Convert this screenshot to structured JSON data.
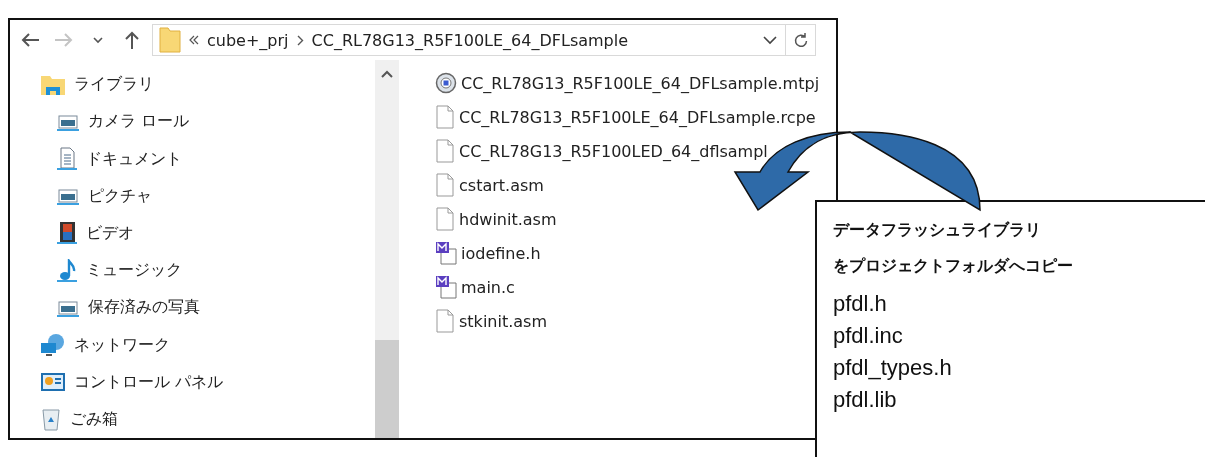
{
  "navigation": [
    {
      "kind": "back",
      "disabled": false
    },
    {
      "kind": "forward",
      "disabled": true
    },
    {
      "kind": "recent",
      "disabled": false
    },
    {
      "kind": "up",
      "disabled": false
    }
  ],
  "address_bar": {
    "path": [
      "cube+_prj",
      "CC_RL78G13_R5F100LE_64_DFLsample"
    ]
  },
  "sidebar": {
    "items": [
      {
        "label": "ライブラリ",
        "kind": "library",
        "children": [
          {
            "label": "カメラ ロール",
            "kind": "picture"
          },
          {
            "label": "ドキュメント",
            "kind": "document"
          },
          {
            "label": "ピクチャ",
            "kind": "picture"
          },
          {
            "label": "ビデオ",
            "kind": "video"
          },
          {
            "label": "ミュージック",
            "kind": "music"
          },
          {
            "label": "保存済みの写真",
            "kind": "picture"
          }
        ]
      },
      {
        "label": "ネットワーク",
        "kind": "network"
      },
      {
        "label": "コントロール パネル",
        "kind": "control-panel"
      },
      {
        "label": "ごみ箱",
        "kind": "trash"
      }
    ]
  },
  "files": [
    {
      "name": "CC_RL78G13_R5F100LE_64_DFLsample.mtpj",
      "kind": "project"
    },
    {
      "name": "CC_RL78G13_R5F100LE_64_DFLsample.rcpe",
      "kind": "plain"
    },
    {
      "name": "CC_RL78G13_R5F100LED_64_dflsampl",
      "kind": "plain"
    },
    {
      "name": "cstart.asm",
      "kind": "plain"
    },
    {
      "name": "hdwinit.asm",
      "kind": "plain"
    },
    {
      "name": "iodefine.h",
      "kind": "source"
    },
    {
      "name": "main.c",
      "kind": "source"
    },
    {
      "name": "stkinit.asm",
      "kind": "plain"
    }
  ],
  "callout": {
    "heading": [
      "データフラッシュライブラリ",
      "をプロジェクトフォルダへコピー"
    ],
    "files": [
      "pfdl.h",
      "pfdl.inc",
      "pfdl_types.h",
      "pfdl.lib"
    ]
  }
}
